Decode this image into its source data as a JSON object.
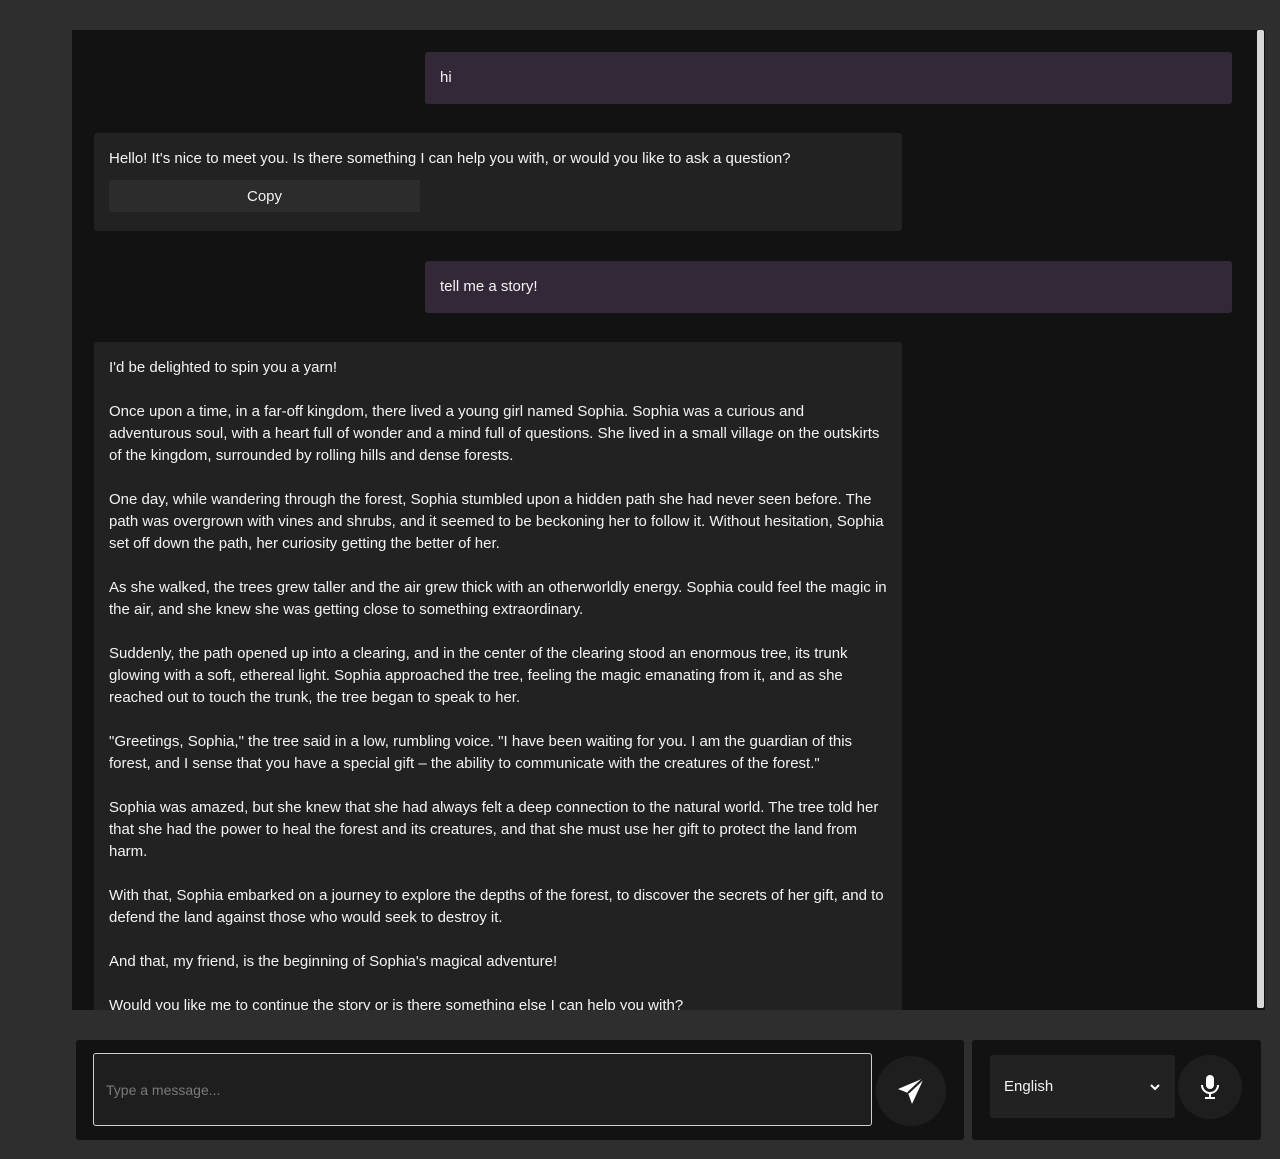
{
  "messages": [
    {
      "role": "user",
      "text": "hi"
    },
    {
      "role": "assistant",
      "text": "Hello! It's nice to meet you. Is there something I can help you with, or would you like to ask a question?",
      "copy_label": "Copy"
    },
    {
      "role": "user",
      "text": "tell me a story!"
    },
    {
      "role": "assistant",
      "paragraphs": [
        "I'd be delighted to spin you a yarn!",
        "Once upon a time, in a far-off kingdom, there lived a young girl named Sophia. Sophia was a curious and adventurous soul, with a heart full of wonder and a mind full of questions. She lived in a small village on the outskirts of the kingdom, surrounded by rolling hills and dense forests.",
        "One day, while wandering through the forest, Sophia stumbled upon a hidden path she had never seen before. The path was overgrown with vines and shrubs, and it seemed to be beckoning her to follow it. Without hesitation, Sophia set off down the path, her curiosity getting the better of her.",
        "As she walked, the trees grew taller and the air grew thick with an otherworldly energy. Sophia could feel the magic in the air, and she knew she was getting close to something extraordinary.",
        "Suddenly, the path opened up into a clearing, and in the center of the clearing stood an enormous tree, its trunk glowing with a soft, ethereal light. Sophia approached the tree, feeling the magic emanating from it, and as she reached out to touch the trunk, the tree began to speak to her.",
        "\"Greetings, Sophia,\" the tree said in a low, rumbling voice. \"I have been waiting for you. I am the guardian of this forest, and I sense that you have a special gift – the ability to communicate with the creatures of the forest.\"",
        "Sophia was amazed, but she knew that she had always felt a deep connection to the natural world. The tree told her that she had the power to heal the forest and its creatures, and that she must use her gift to protect the land from harm.",
        "With that, Sophia embarked on a journey to explore the depths of the forest, to discover the secrets of her gift, and to defend the land against those who would seek to destroy it.",
        "And that, my friend, is the beginning of Sophia's magical adventure!",
        "Would you like me to continue the story or is there something else I can help you with?"
      ]
    }
  ],
  "input": {
    "placeholder": "Type a message..."
  },
  "language": {
    "selected": "English"
  },
  "icons": {
    "send": "send-icon",
    "microphone": "microphone-icon",
    "dropdown": "chevron-down-icon"
  }
}
